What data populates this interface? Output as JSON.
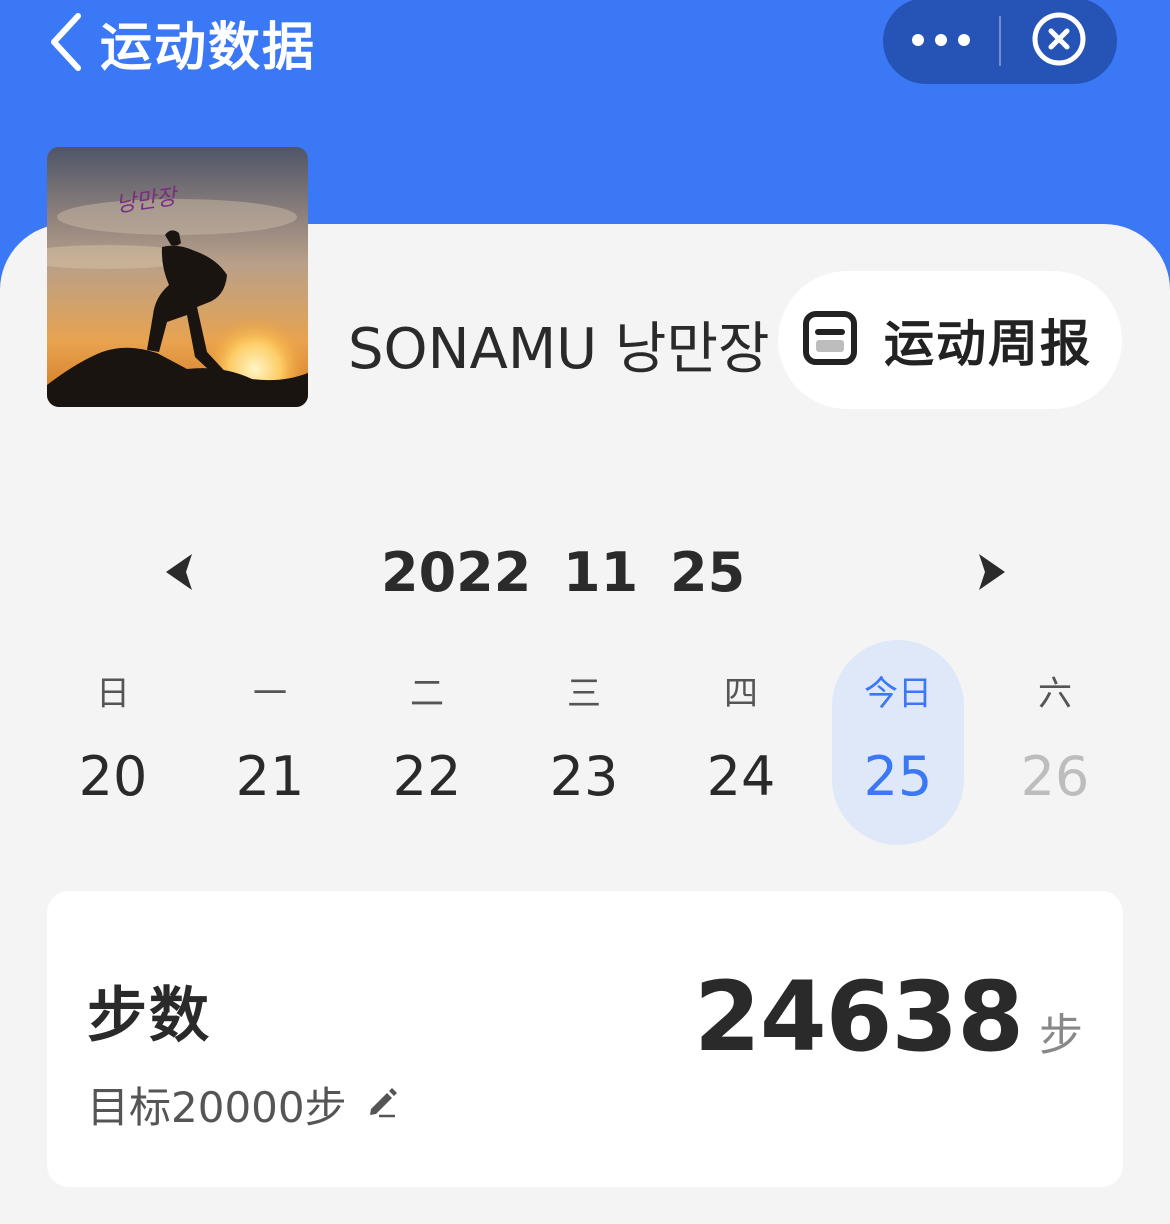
{
  "header": {
    "title": "运动数据",
    "colors": {
      "primary": "#3b78f5",
      "capsule": "#2654b6"
    }
  },
  "profile": {
    "name": "SONAMU 낭만장",
    "weekly_report_label": "运动周报"
  },
  "date": {
    "year": "2022",
    "month": "11",
    "day": "25"
  },
  "week": [
    {
      "weekday": "日",
      "day": "20"
    },
    {
      "weekday": "一",
      "day": "21"
    },
    {
      "weekday": "二",
      "day": "22"
    },
    {
      "weekday": "三",
      "day": "23"
    },
    {
      "weekday": "四",
      "day": "24"
    },
    {
      "weekday": "今日",
      "day": "25"
    },
    {
      "weekday": "六",
      "day": "26"
    }
  ],
  "steps_card": {
    "title": "步数",
    "goal": "目标20000步",
    "value": "24638",
    "unit": "步"
  }
}
